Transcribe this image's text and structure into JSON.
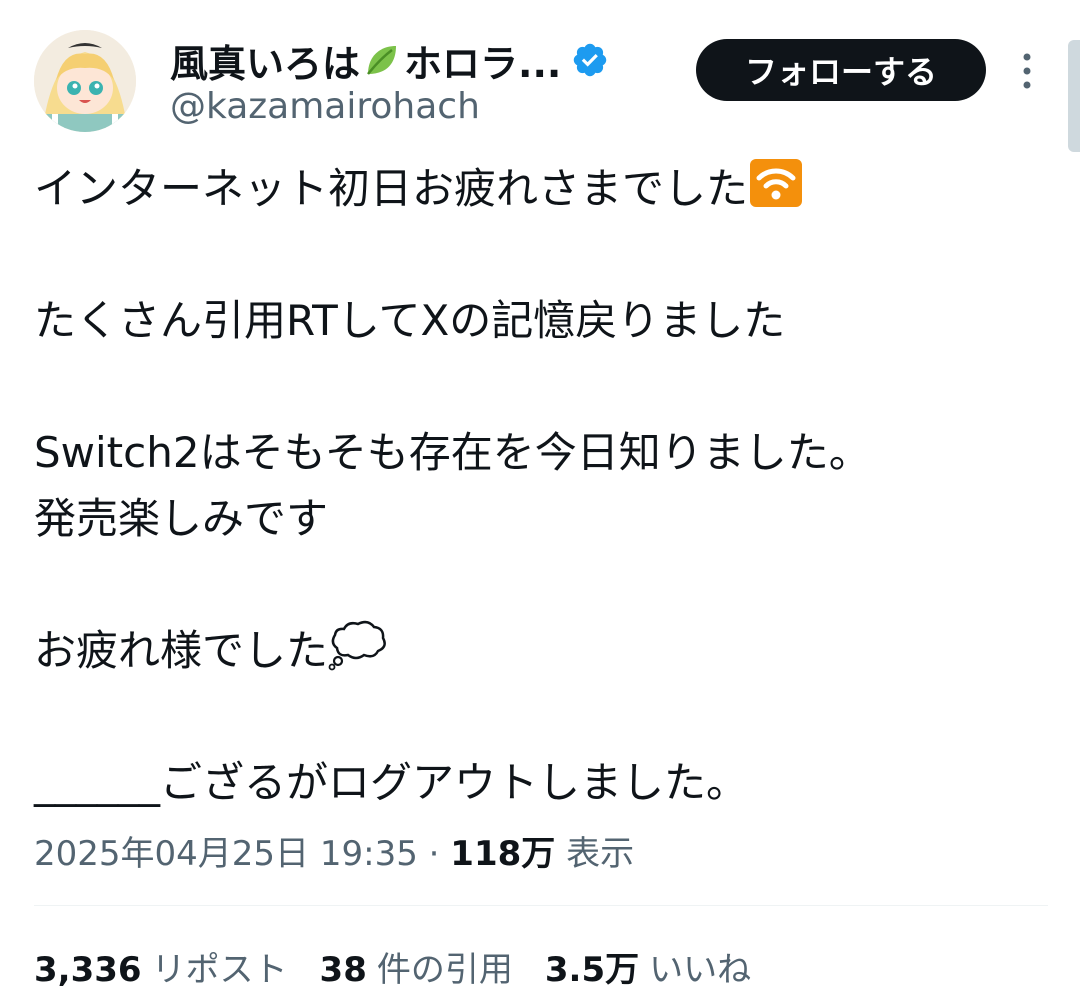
{
  "author": {
    "display_name": "風真いろは",
    "display_name_suffix": "ホロラ...",
    "handle": "@kazamairohach",
    "name_emoji": "leaf-icon",
    "verified_icon": "verified-badge-icon",
    "verified_color": "#1d9bf0"
  },
  "actions": {
    "follow_label": "フォローする",
    "more_icon": "more-vertical-icon"
  },
  "tweet": {
    "line1": "インターネット初日お疲れさまでした",
    "line1_emoji": "antenna-bars-icon",
    "line2": "たくさん引用RTしてXの記憶戻りました",
    "line3": "Switch2はそもそも存在を今日知りました。",
    "line4": "発売楽しみです",
    "line5": "お疲れ様でした",
    "line5_emoji": "thought-balloon-icon",
    "line6": "______ござるがログアウトしました。"
  },
  "meta": {
    "timestamp": "2025年04月25日 19:35",
    "separator": "·",
    "views_count": "118万",
    "views_label": "表示"
  },
  "stats": {
    "reposts_count": "3,336",
    "reposts_label": "リポスト",
    "quotes_count": "38",
    "quotes_label": "件の引用",
    "likes_count": "3.5万",
    "likes_label": "いいね"
  },
  "colors": {
    "text_primary": "#0f1419",
    "text_secondary": "#536471",
    "button_bg": "#0f1419",
    "emoji_orange": "#f4900c"
  }
}
